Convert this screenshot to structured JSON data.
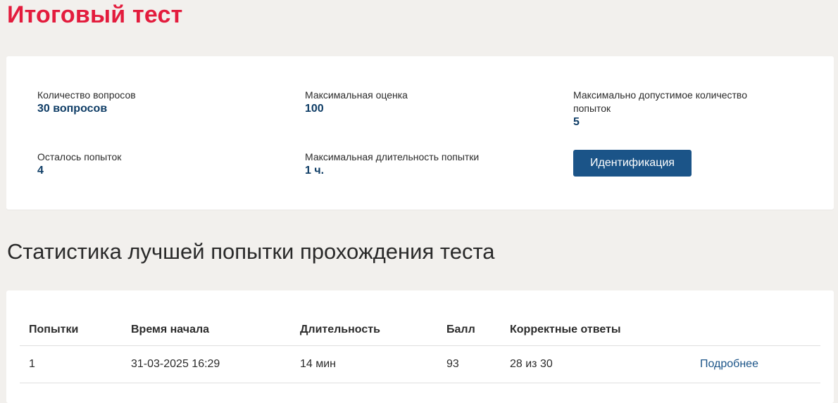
{
  "page": {
    "title": "Итоговый тест"
  },
  "info": {
    "questions_label": "Количество вопросов",
    "questions_value": "30 вопросов",
    "max_score_label": "Максимальная оценка",
    "max_score_value": "100",
    "max_attempts_label": "Максимально допустимое количество попыток",
    "max_attempts_value": "5",
    "remaining_label": "Осталось попыток",
    "remaining_value": "4",
    "max_duration_label": "Максимальная длительность попытки",
    "max_duration_value": "1 ч.",
    "identify_button": "Идентификация"
  },
  "stats": {
    "title": "Статистика лучшей попытки прохождения теста",
    "columns": [
      "Попытки",
      "Время начала",
      "Длительность",
      "Балл",
      "Корректные ответы"
    ],
    "rows": [
      {
        "attempt": "1",
        "start_time": "31-03-2025 16:29",
        "duration": "14 мин",
        "score": "93",
        "correct": "28 из 30",
        "details_link": "Подробнее"
      }
    ]
  },
  "colors": {
    "title_red": "#e31c3d",
    "value_blue": "#0f3d66",
    "button_blue": "#1b5488",
    "background": "#f2f0ed"
  }
}
